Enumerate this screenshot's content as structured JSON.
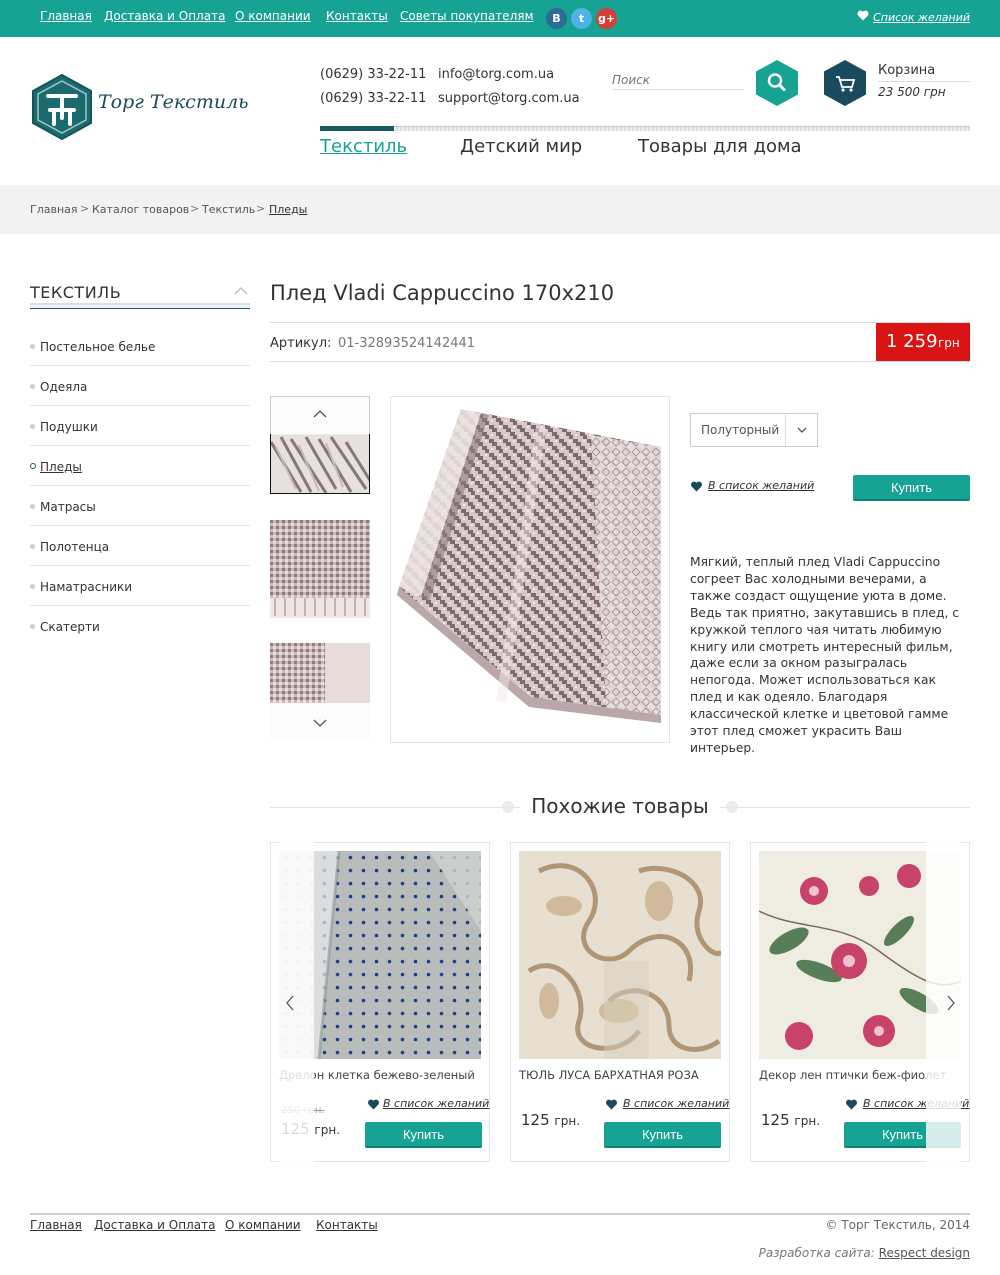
{
  "topnav": {
    "links": [
      "Главная",
      "Доставка и Оплата",
      "О компании",
      "Контакты",
      "Советы покупателям"
    ],
    "social": [
      "B",
      "t",
      "g+"
    ],
    "wishlist": "Список желаний"
  },
  "header": {
    "logo_text": "Торг Текстиль",
    "phones": [
      "(0629) 33-22-11",
      "(0629) 33-22-11"
    ],
    "emails": [
      "info@torg.com.ua",
      "support@torg.com.ua"
    ],
    "search_placeholder": "Поиск",
    "cart_label": "Корзина",
    "cart_sum": "23 500 грн"
  },
  "menu": {
    "items": [
      "Текстиль",
      "Детский мир",
      "Товары для дома"
    ],
    "active": "Текстиль"
  },
  "breadcrumb": [
    "Главная",
    "Каталог товаров",
    "Текстиль",
    "Пледы"
  ],
  "sidebar": {
    "title": "ТЕКСТИЛЬ",
    "items": [
      "Постельное белье",
      "Одеяла",
      "Подушки",
      "Пледы",
      "Матрасы",
      "Полотенца",
      "Наматрасники",
      "Скатерти"
    ],
    "active": "Пледы"
  },
  "product": {
    "title": "Плед Vladi Cappuccino 170x210",
    "article_label": "Артикул:",
    "article_value": "01-32893524142441",
    "price": "1 259",
    "currency": "грн",
    "size_selected": "Полуторный",
    "wishlist": "В список желаний",
    "buy": "Купить",
    "description": "Мягкий, теплый плед Vladi Cappuccino согреет Вас холодными вечерами, а также создаст ощущение уюта в доме. Ведь так приятно, закутавшись в плед, с кружкой теплого чая читать любимую книгу или смотреть интересный фильм, даже если за окном разыгралась непогода. Может использоваться как плед и как одеяло. Благодаря классической клетке и цветовой гамме этот плед сможет украсить Ваш интерьер."
  },
  "similar": {
    "title": "Похожие товары",
    "cards": [
      {
        "name": "Дралон клетка бежево-зеленый",
        "old_price": "250 грн.",
        "price": "125",
        "currency": "грн.",
        "wishlist": "В список желаний",
        "buy": "Купить"
      },
      {
        "name": "ТЮЛЬ ЛУСА БАРХАТНАЯ РОЗА",
        "price": "125",
        "currency": "грн.",
        "wishlist": "В список желаний",
        "buy": "Купить"
      },
      {
        "name": "Декор лен птички беж-фиолет",
        "price": "125",
        "currency": "грн.",
        "wishlist": "В список желаний",
        "buy": "Купить"
      }
    ]
  },
  "footer": {
    "links": [
      "Главная",
      "Доставка и Оплата",
      "О компании",
      "Контакты"
    ],
    "copyright": "© Торг Текстиль, 2014",
    "dev_label": "Разработка сайта:",
    "dev_link": "Respect design"
  },
  "colors": {
    "accent": "#17a394",
    "dark": "#1a5c66",
    "price_red": "#d81414"
  }
}
